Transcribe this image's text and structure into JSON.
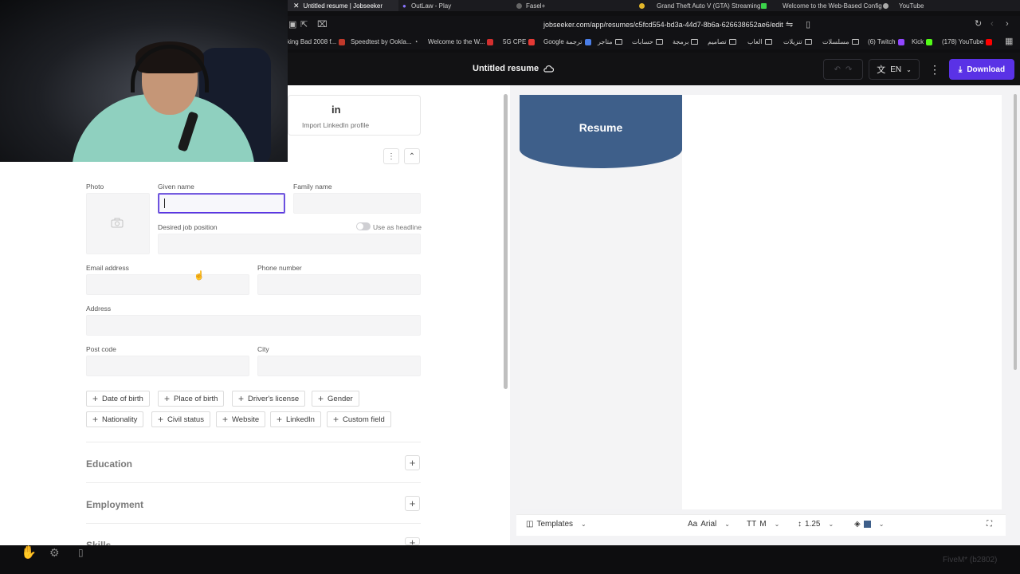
{
  "browser": {
    "tabs": [
      {
        "label": "Untitled resume | Jobseeker",
        "active": true
      },
      {
        "label": "OutLaw - Play"
      },
      {
        "label": "Fasel+"
      },
      {
        "label": "Grand Theft Auto V (GTA) Streaming"
      },
      {
        "label": "Welcome to the Web-Based Config"
      },
      {
        "label": "YouTube"
      }
    ],
    "url": "jobseeker.com/app/resumes/c5fcd554-bd3a-44d7-8b6a-626638652ae6/edit",
    "bookmarks": [
      "king Bad 2008 f...",
      "Speedtest by Ookla...",
      "Welcome to the W...",
      "5G CPE",
      "Google ترجمة",
      "متاجر",
      "حسابات",
      "برمجة",
      "تصاميم",
      "العاب",
      "تنزيلات",
      "مسلسلات",
      "(6) Twitch",
      "Kick",
      "(178) YouTube"
    ]
  },
  "header": {
    "title": "Untitled resume",
    "language": "EN",
    "download_label": "Download",
    "icons": [
      "cloud-icon",
      "undo-icon",
      "redo-icon",
      "translate-icon",
      "more-icon",
      "download-icon"
    ]
  },
  "editor": {
    "linkedin_label": "Import LinkedIn profile",
    "linkedin_logo": "in",
    "labels": {
      "photo": "Photo",
      "given_name": "Given name",
      "family_name": "Family name",
      "desired_job": "Desired job position",
      "use_as_headline": "Use as headline",
      "email": "Email address",
      "phone": "Phone number",
      "address": "Address",
      "post_code": "Post code",
      "city": "City"
    },
    "values": {
      "given_name": "",
      "family_name": "",
      "desired_job": "",
      "email": "",
      "phone": "",
      "address": "",
      "post_code": "",
      "city": ""
    },
    "use_as_headline_on": false,
    "optional_fields": [
      "Date of birth",
      "Place of birth",
      "Driver's license",
      "Gender",
      "Nationality",
      "Civil status",
      "Website",
      "LinkedIn",
      "Custom field"
    ],
    "sections": [
      "Education",
      "Employment",
      "Skills"
    ]
  },
  "preview": {
    "heading": "Resume",
    "accent_color": "#3e5f8a",
    "toolbar": {
      "templates": "Templates",
      "font_prefix": "Aa",
      "font": "Arial",
      "size_prefix": "TT",
      "size": "M",
      "line_spacing": "1.25"
    }
  },
  "overlay": {
    "watermark": "FiveM* (b2802)"
  },
  "colors": {
    "brand": "#5a32e6",
    "header_bg": "#121214",
    "resume_banner": "#3e5f8a"
  }
}
